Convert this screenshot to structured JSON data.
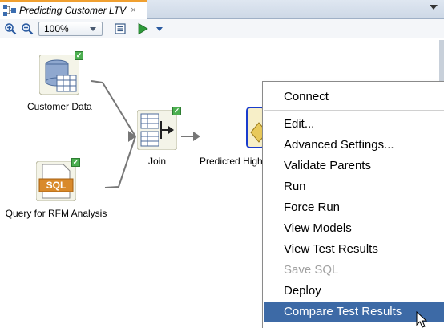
{
  "tab": {
    "title": "Predicting Customer LTV",
    "close": "×"
  },
  "toolbar": {
    "zoom": "100%"
  },
  "nodes": {
    "customer_data": "Customer Data",
    "query_rfm": "Query for RFM Analysis",
    "join": "Join",
    "predicted_high": "Predicted High"
  },
  "menu": {
    "items": [
      "Connect",
      "Edit...",
      "Advanced Settings...",
      "Validate Parents",
      "Run",
      "Force Run",
      "View Models",
      "View Test Results",
      "Save SQL",
      "Deploy",
      "Compare Test Results"
    ]
  },
  "colors": {
    "selected": "#3d6aa6",
    "disabled": "#a0a0a0",
    "check": "#4caf50",
    "tab_accent": "#f0a030"
  }
}
